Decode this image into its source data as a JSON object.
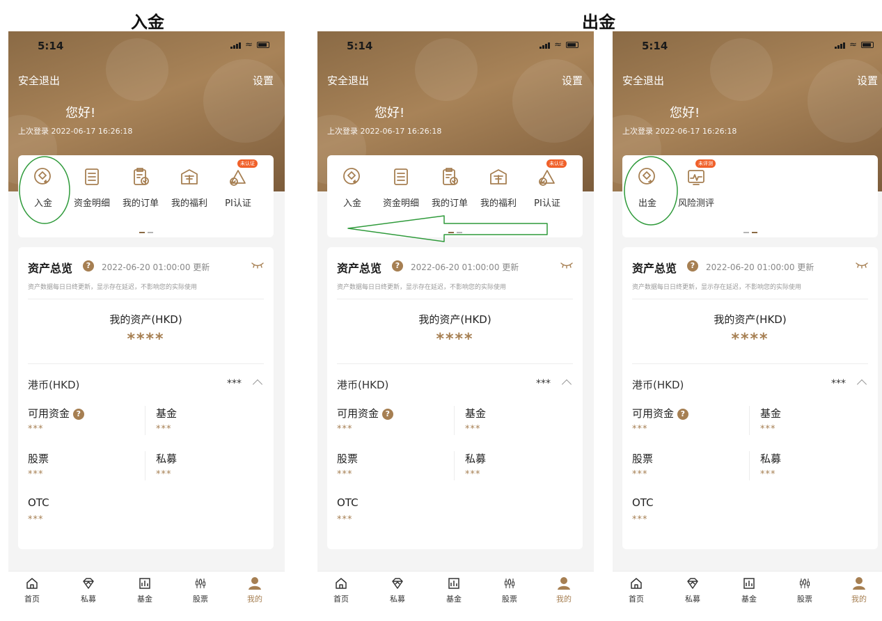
{
  "labels": {
    "deposit_section": "入金",
    "withdraw_section": "出金"
  },
  "status": {
    "time": "5:14"
  },
  "header": {
    "logout": "安全退出",
    "settings": "设置",
    "greeting": "您好!",
    "last_login": "上次登录 2022-06-17 16:26:18"
  },
  "menu_full": [
    {
      "label": "入金",
      "icon": "deposit-icon"
    },
    {
      "label": "资金明细",
      "icon": "fund-detail-icon"
    },
    {
      "label": "我的订单",
      "icon": "order-icon"
    },
    {
      "label": "我的福利",
      "icon": "gift-icon"
    },
    {
      "label": "PI认证",
      "icon": "pi-cert-icon",
      "badge": "未认证"
    }
  ],
  "menu_page2": [
    {
      "label": "出金",
      "icon": "withdraw-icon"
    },
    {
      "label": "风险测评",
      "icon": "risk-assessment-icon",
      "badge": "未评测"
    }
  ],
  "assets": {
    "title": "资产总览",
    "help": "?",
    "updated": "2022-06-20 01:00:00 更新",
    "note": "资产数据每日日终更新，显示存在延迟，不影响您的实际使用",
    "total_label": "我的资产(HKD)",
    "total_value": "****",
    "currency": "港币(HKD)",
    "currency_value": "***",
    "items": [
      {
        "label": "可用资金",
        "value": "***"
      },
      {
        "label": "基金",
        "value": "***"
      },
      {
        "label": "股票",
        "value": "***"
      },
      {
        "label": "私募",
        "value": "***"
      },
      {
        "label": "OTC",
        "value": "***"
      }
    ]
  },
  "tabs": [
    {
      "label": "首页",
      "icon": "home-icon"
    },
    {
      "label": "私募",
      "icon": "diamond-icon"
    },
    {
      "label": "基金",
      "icon": "fund-icon"
    },
    {
      "label": "股票",
      "icon": "candlestick-icon"
    },
    {
      "label": "我的",
      "icon": "profile-icon"
    }
  ],
  "colors": {
    "accent": "#a67f52",
    "badge": "#f0602a",
    "annotation": "#2e9a3a"
  }
}
